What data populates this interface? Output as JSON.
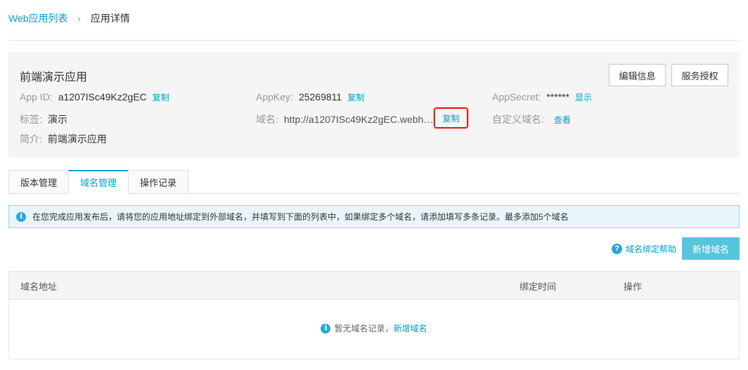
{
  "breadcrumb": {
    "parent": "Web应用列表",
    "separator": "›",
    "current": "应用详情"
  },
  "app": {
    "name": "前端演示应用",
    "buttons": {
      "edit": "编辑信息",
      "auth": "服务授权"
    },
    "fields": {
      "app_id": {
        "label": "App ID:",
        "value": "a1207ISc49Kz2gEC",
        "action": "复制"
      },
      "app_key": {
        "label": "AppKey:",
        "value": "25269811",
        "action": "复制"
      },
      "app_secret": {
        "label": "AppSecret:",
        "value": "******",
        "action": "显示"
      },
      "tag": {
        "label": "标签:",
        "value": "演示"
      },
      "domain": {
        "label": "域名:",
        "value": "http://a1207ISc49Kz2gEC.webh…",
        "action": "复制"
      },
      "custom_domain": {
        "label": "自定义域名:",
        "action": "查看"
      },
      "intro": {
        "label": "简介:",
        "value": "前端演示应用"
      }
    }
  },
  "tabs": [
    {
      "label": "版本管理",
      "active": false
    },
    {
      "label": "域名管理",
      "active": true
    },
    {
      "label": "操作记录",
      "active": false
    }
  ],
  "notice": {
    "icon": "info-icon",
    "text": "在您完成应用发布后，请将您的应用地址绑定到外部域名，并填写到下面的列表中，如果绑定多个域名，请添加填写多条记录。最多添加5个域名"
  },
  "help_link": {
    "icon": "question-icon",
    "label": "域名绑定帮助"
  },
  "add_button": "新增域名",
  "table": {
    "columns": [
      "域名地址",
      "绑定时间",
      "操作"
    ],
    "empty_text": "暂无域名记录，",
    "empty_link": "新增域名"
  },
  "colors": {
    "accent": "#00a2ca",
    "highlight": "#e0261b",
    "primary_button": "#55c6dc"
  }
}
